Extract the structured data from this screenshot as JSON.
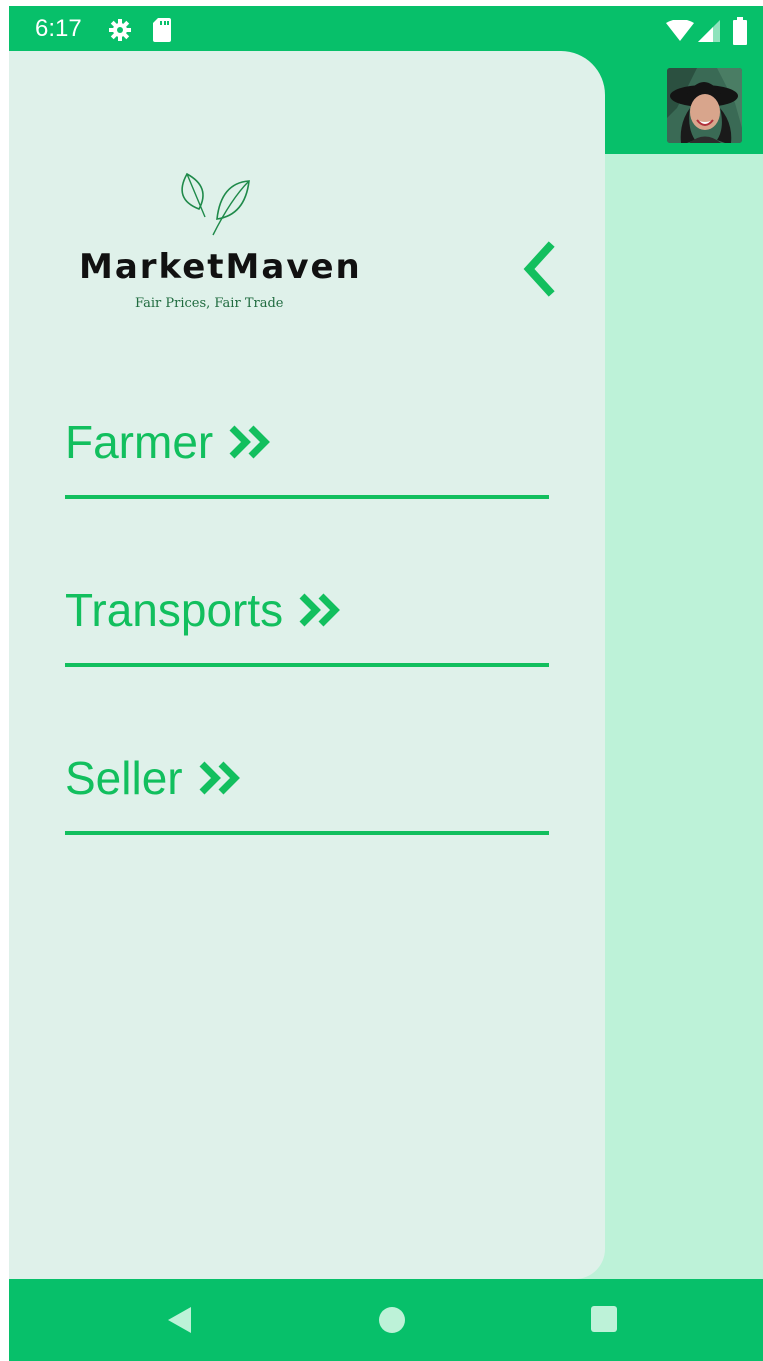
{
  "status_bar": {
    "time": "6:17",
    "icons": [
      "gear-icon",
      "sd-card-icon",
      "wifi-icon",
      "signal-icon",
      "battery-icon"
    ]
  },
  "header": {
    "avatar": "profile-photo"
  },
  "drawer": {
    "logo": {
      "name": "MarketMaven",
      "tagline": "Fair Prices, Fair Trade"
    },
    "back_icon": "chevron-left-icon",
    "items": [
      {
        "label": "Farmer",
        "icon": "double-chevron-right-icon"
      },
      {
        "label": "Transports",
        "icon": "double-chevron-right-icon"
      },
      {
        "label": "Seller",
        "icon": "double-chevron-right-icon"
      }
    ]
  },
  "nav_bar": {
    "buttons": [
      "back-triangle-icon",
      "home-circle-icon",
      "recents-square-icon"
    ]
  },
  "colors": {
    "accent": "#07c06a",
    "drawer_bg": "#dff1ea",
    "content_bg": "#bdf2d8",
    "menu_text": "#12bf5e"
  }
}
